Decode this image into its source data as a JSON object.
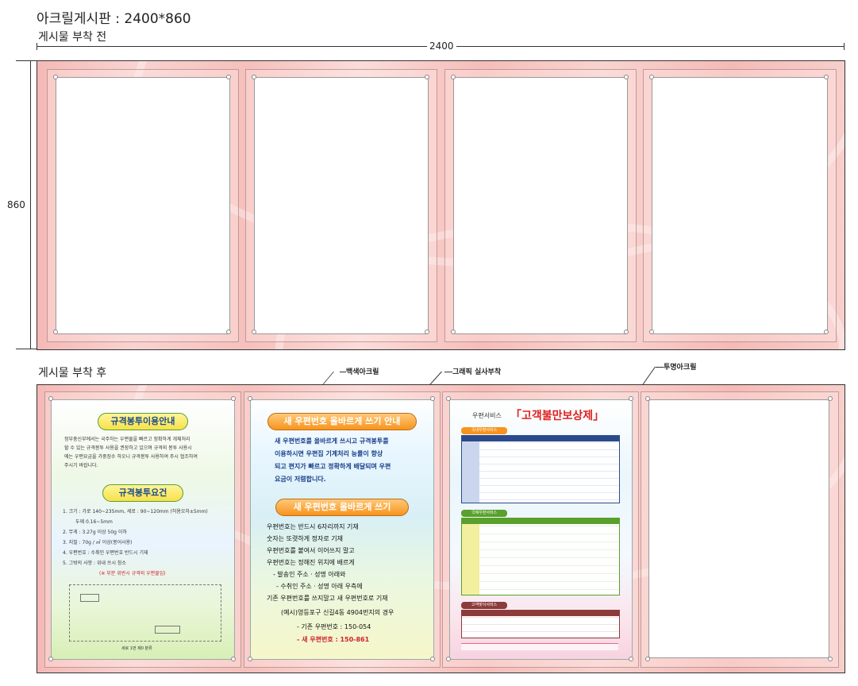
{
  "header": {
    "title": "아크릴게시판 : 2400*860",
    "before_label": "게시물 부착 전",
    "after_label": "게시물 부착 후"
  },
  "dimensions": {
    "width_label": "2400",
    "height_label": "860"
  },
  "callouts": {
    "white_acrylic": "백색아크릴",
    "graphic_print": "그래픽 실사부착",
    "clear_acrylic": "투명아크릴"
  },
  "poster1": {
    "title1": "규격봉투이용안내",
    "intro": [
      "정부충신부에서는 국주하는 우편물을 빠르고 정확하게 개체처리",
      "할 수 있는 규격봉투 사용을 권장하고 있으며 규격외 봉투 사용시",
      "에는 우편요금을 가중징수 하오니 규격봉투 사용하여 주시 협조하여",
      "주시기 바랍니다."
    ],
    "title2": "규격봉투요건",
    "items": [
      "1. 크기 : 가로 140~235mm, 세로 : 90~120mm (허용오차±5mm)",
      "   두께 0.16~5mm",
      "2. 무게 : 3.27g 이상 50g 이하",
      "3. 지질 : 70g / ㎡ 이상(봉어사용)",
      "4. 우편번호 : 수취인 우편번호 반드시 기재",
      "5. 그밖의 사항 : 위내 쓰시 창소"
    ],
    "note": "(※ 부분 위반시 규격외 우편물임)",
    "diagram_bottom": "세로 1번  제0 분류"
  },
  "poster2": {
    "title1": "새 우편번호 올바르게 쓰기 안내",
    "intro": [
      "새 우편번호를 올바르게 쓰시고 규격봉투를",
      "이용하시면 우편집 기계처리 능률이 향상",
      "되고 편지가 빠르고 정확하게 배달되며 우편",
      "요금이 저렴합니다."
    ],
    "title2": "새 우편번호 올바르게 쓰기",
    "items": [
      "우편번호는 반드시 6자리까지 기재",
      "숫자는 또렷하게 정자로 기재",
      "우편번호를 붙여서 이어쓰지 말고",
      "우편번호는 정해진 위치에 배르게",
      "- 발송인 주소ㆍ성명 아래와",
      "- 수취인 주소ㆍ성명 아래 우측에",
      "기존 우편번호를 쓰지말고 새 우편번호로 기재"
    ],
    "example": "(예시)영등포구 신길4동 4904번지의 경우",
    "old_code": "- 기존 우편번호 : 150-054",
    "new_code": "- 새 우편번호 : 150-861"
  },
  "poster3": {
    "prefix": "우편서비스",
    "title": "「고객불만보상제」",
    "section1": "국내우편서비스",
    "section2": "국제우편서비스",
    "section3": "고객맞이서비스"
  },
  "colors": {
    "board_pink": "#f6c0bc",
    "pill_orange": "#f7941d",
    "pill_green": "#8dc63f",
    "title_red": "#e02020",
    "table_blue": "#2b4a8c",
    "table_green": "#5aa02c",
    "table_maroon": "#8c3b3b"
  }
}
